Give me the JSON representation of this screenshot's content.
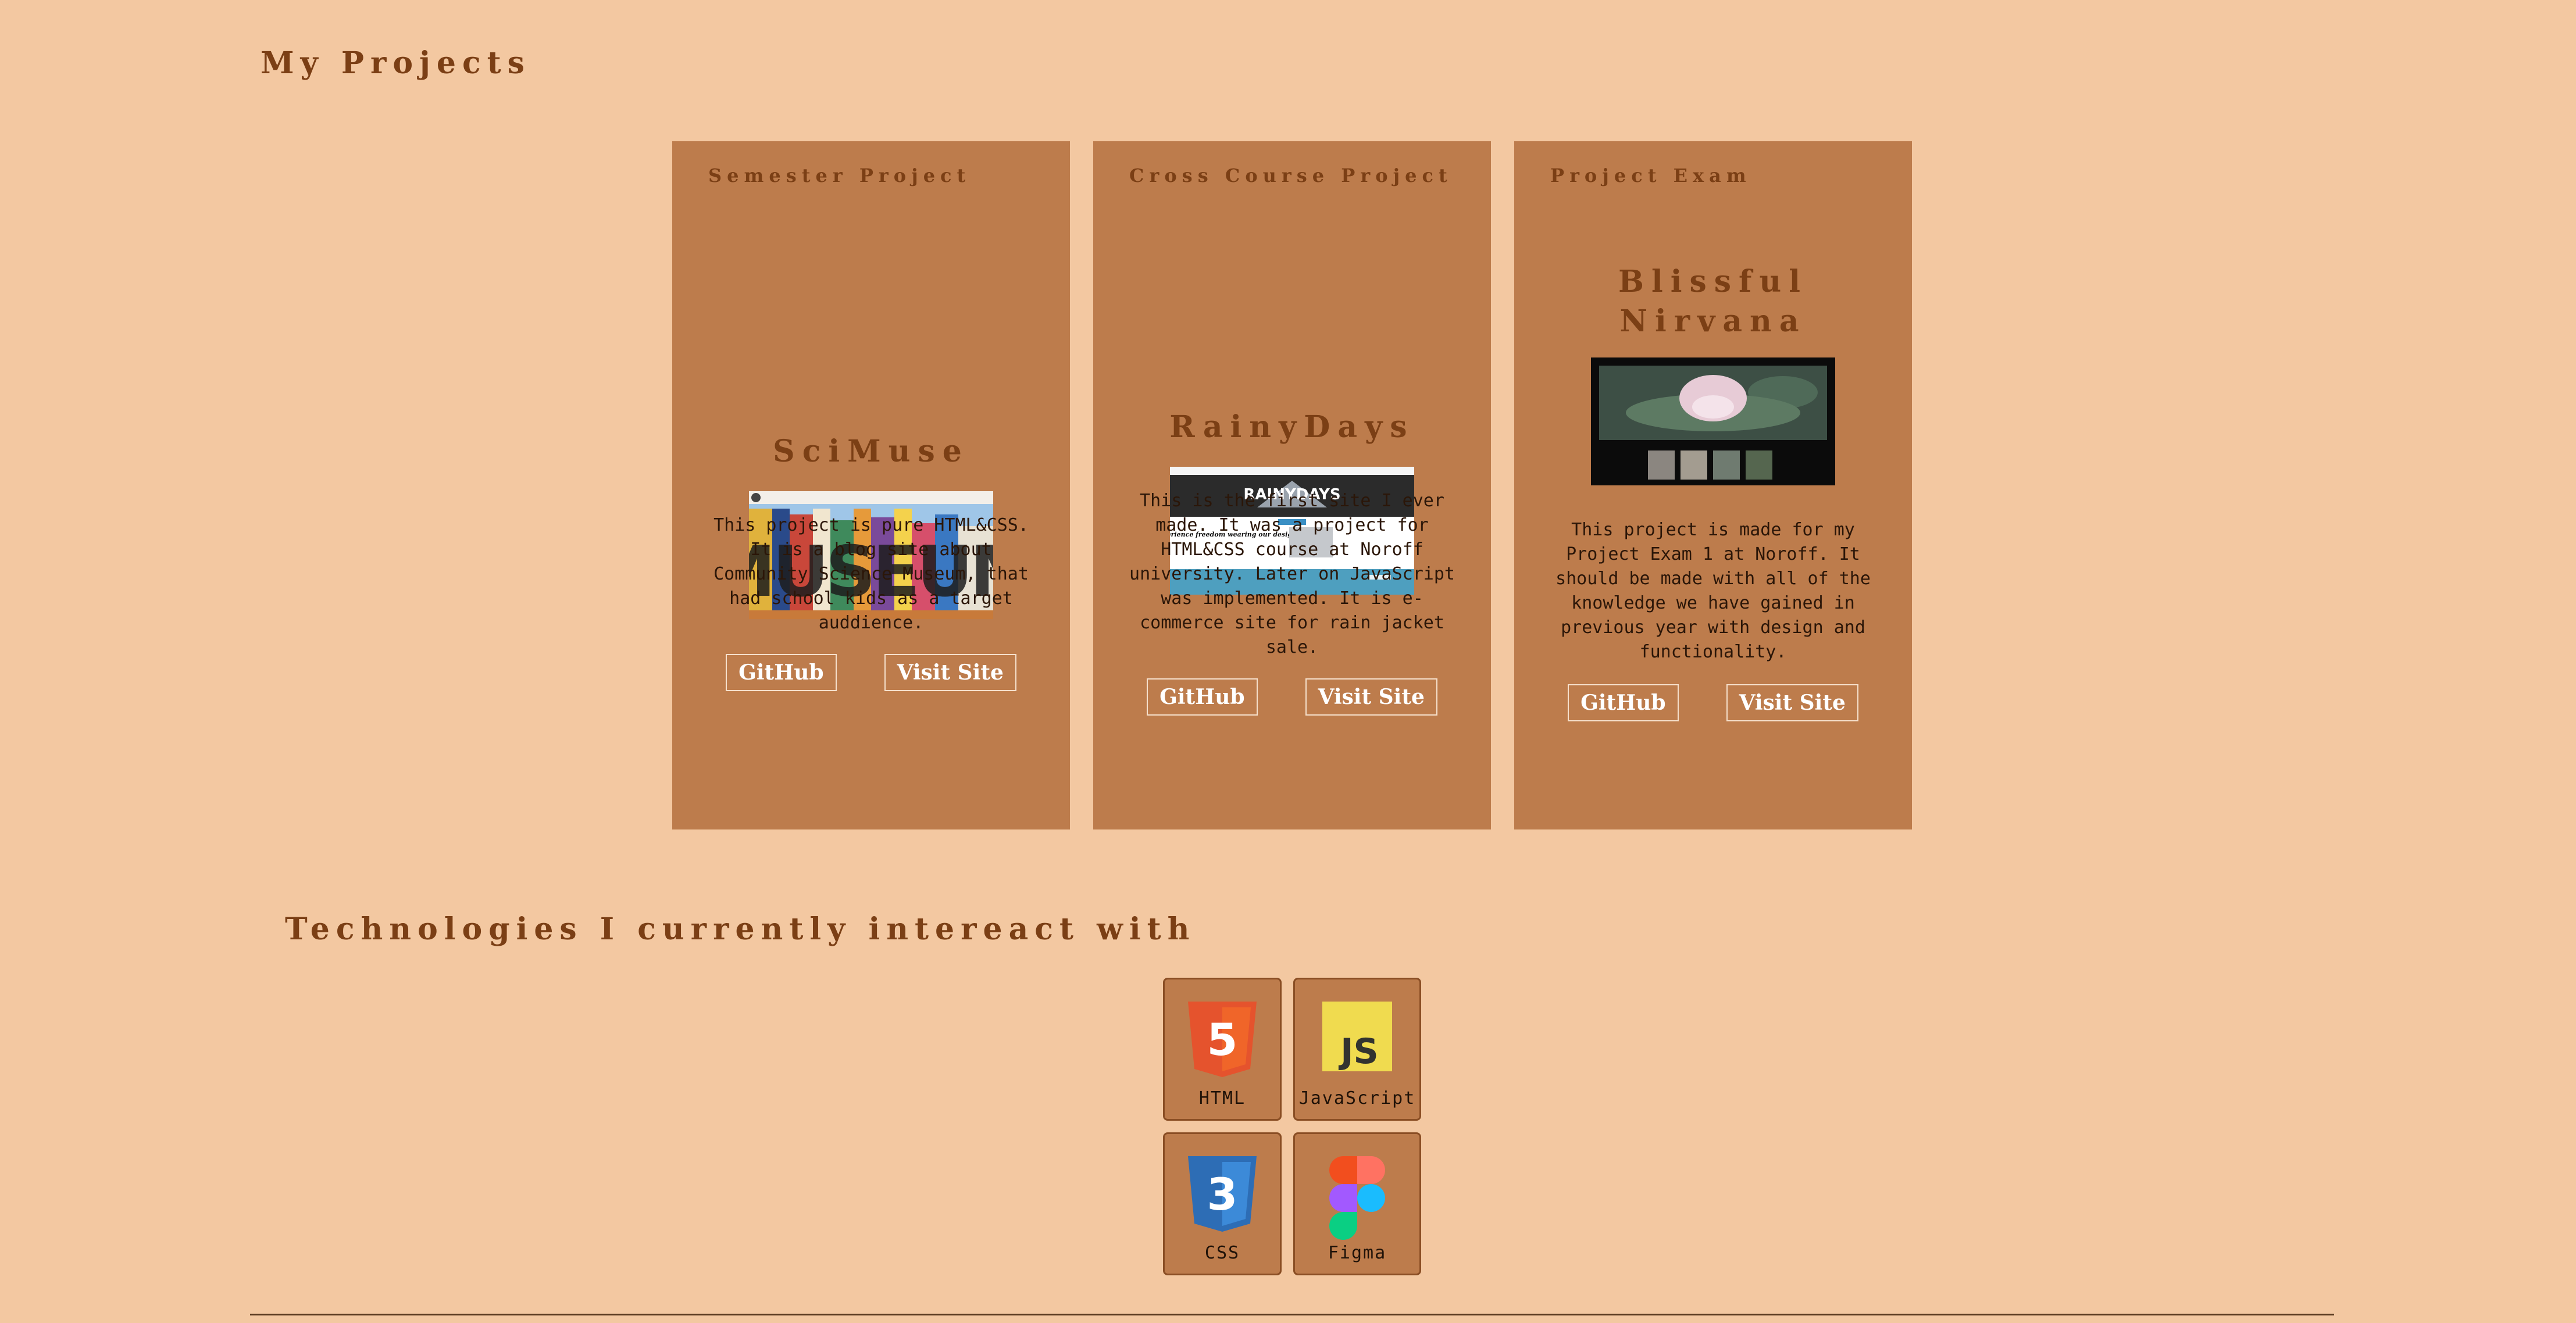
{
  "page": {
    "title": "My Projects"
  },
  "projects": [
    {
      "label": "Semester Project",
      "name": "SciMuse",
      "screenshot_text": "MUSEUM",
      "description": "This project is pure HTML&CSS. It is a blog site about Community Science Museum, that had school kids as a target auddience.",
      "github_label": "GitHub",
      "visit_label": "Visit Site"
    },
    {
      "label": "Cross Course Project",
      "name": "RainyDays",
      "screenshot_text": "RAINYDAYS",
      "screenshot_subtext": "Experience freedom wearing our design",
      "description": "This is the first site I ever made. It was a project for HTML&CSS course at Noroff university. Later on JavaScript was implemented. It is e-commerce site for rain jacket sale.",
      "github_label": "GitHub",
      "visit_label": "Visit Site"
    },
    {
      "label": "Project Exam",
      "name": "Blissful Nirvana",
      "description": "This project is made for my Project Exam 1 at Noroff. It should be made with all of the knowledge we have gained in previous year with design and functionality.",
      "github_label": "GitHub",
      "visit_label": "Visit Site"
    }
  ],
  "technologies": {
    "title": "Technologies I currently intereact with",
    "items": [
      {
        "name": "HTML",
        "icon": "html5-icon",
        "badge": "5",
        "color": "#e5532d"
      },
      {
        "name": "JavaScript",
        "icon": "javascript-icon",
        "badge": "JS",
        "color": "#f0db4f"
      },
      {
        "name": "CSS",
        "icon": "css3-icon",
        "badge": "3",
        "color": "#2d6db5"
      },
      {
        "name": "Figma",
        "icon": "figma-icon"
      }
    ]
  },
  "colors": {
    "background": "#f3c8a1",
    "card": "#bd7c4c",
    "heading": "#7b3f15"
  }
}
